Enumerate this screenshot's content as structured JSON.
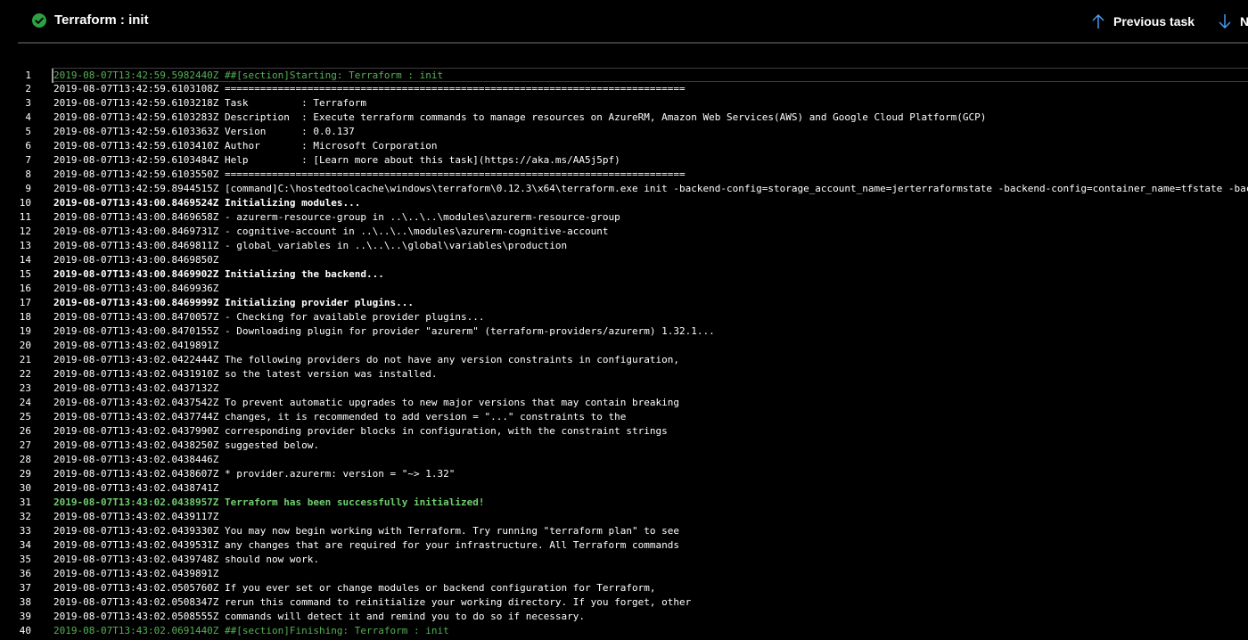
{
  "header": {
    "task_title": "Terraform : init",
    "status": "succeeded",
    "status_color": "#2ea043",
    "prev_label": "Previous task",
    "next_label": "N"
  },
  "log": {
    "lines": [
      {
        "num": "1",
        "text": "2019-08-07T13:42:59.5982440Z ##[section]Starting: Terraform : init",
        "style": "section first"
      },
      {
        "num": "2",
        "text": "2019-08-07T13:42:59.6103108Z ==============================================================================",
        "style": ""
      },
      {
        "num": "3",
        "text": "2019-08-07T13:42:59.6103218Z Task         : Terraform",
        "style": ""
      },
      {
        "num": "4",
        "text": "2019-08-07T13:42:59.6103283Z Description  : Execute terraform commands to manage resources on AzureRM, Amazon Web Services(AWS) and Google Cloud Platform(GCP)",
        "style": ""
      },
      {
        "num": "5",
        "text": "2019-08-07T13:42:59.6103363Z Version      : 0.0.137",
        "style": ""
      },
      {
        "num": "6",
        "text": "2019-08-07T13:42:59.6103410Z Author       : Microsoft Corporation",
        "style": ""
      },
      {
        "num": "7",
        "text": "2019-08-07T13:42:59.6103484Z Help         : [Learn more about this task](https://aka.ms/AA5j5pf)",
        "style": ""
      },
      {
        "num": "8",
        "text": "2019-08-07T13:42:59.6103550Z ==============================================================================",
        "style": ""
      },
      {
        "num": "9",
        "text": "2019-08-07T13:42:59.8944515Z [command]C:\\hostedtoolcache\\windows\\terraform\\0.12.3\\x64\\terraform.exe init -backend-config=storage_account_name=jerterraformstate -backend-config=container_name=tfstate -backend-config=key=production.terraform.tfstate",
        "style": ""
      },
      {
        "num": "10",
        "text": "2019-08-07T13:43:00.8469524Z Initializing modules...",
        "style": "bold"
      },
      {
        "num": "11",
        "text": "2019-08-07T13:43:00.8469658Z - azurerm-resource-group in ..\\..\\..\\modules\\azurerm-resource-group",
        "style": ""
      },
      {
        "num": "12",
        "text": "2019-08-07T13:43:00.8469731Z - cognitive-account in ..\\..\\..\\modules\\azurerm-cognitive-account",
        "style": ""
      },
      {
        "num": "13",
        "text": "2019-08-07T13:43:00.8469811Z - global_variables in ..\\..\\..\\global\\variables\\production",
        "style": ""
      },
      {
        "num": "14",
        "text": "2019-08-07T13:43:00.8469850Z",
        "style": ""
      },
      {
        "num": "15",
        "text": "2019-08-07T13:43:00.8469902Z Initializing the backend...",
        "style": "bold"
      },
      {
        "num": "16",
        "text": "2019-08-07T13:43:00.8469936Z",
        "style": ""
      },
      {
        "num": "17",
        "text": "2019-08-07T13:43:00.8469999Z Initializing provider plugins...",
        "style": "bold"
      },
      {
        "num": "18",
        "text": "2019-08-07T13:43:00.8470057Z - Checking for available provider plugins...",
        "style": ""
      },
      {
        "num": "19",
        "text": "2019-08-07T13:43:00.8470155Z - Downloading plugin for provider \"azurerm\" (terraform-providers/azurerm) 1.32.1...",
        "style": ""
      },
      {
        "num": "20",
        "text": "2019-08-07T13:43:02.0419891Z",
        "style": ""
      },
      {
        "num": "21",
        "text": "2019-08-07T13:43:02.0422444Z The following providers do not have any version constraints in configuration,",
        "style": ""
      },
      {
        "num": "22",
        "text": "2019-08-07T13:43:02.0431910Z so the latest version was installed.",
        "style": ""
      },
      {
        "num": "23",
        "text": "2019-08-07T13:43:02.0437132Z",
        "style": ""
      },
      {
        "num": "24",
        "text": "2019-08-07T13:43:02.0437542Z To prevent automatic upgrades to new major versions that may contain breaking",
        "style": ""
      },
      {
        "num": "25",
        "text": "2019-08-07T13:43:02.0437744Z changes, it is recommended to add version = \"...\" constraints to the",
        "style": ""
      },
      {
        "num": "26",
        "text": "2019-08-07T13:43:02.0437990Z corresponding provider blocks in configuration, with the constraint strings",
        "style": ""
      },
      {
        "num": "27",
        "text": "2019-08-07T13:43:02.0438250Z suggested below.",
        "style": ""
      },
      {
        "num": "28",
        "text": "2019-08-07T13:43:02.0438446Z",
        "style": ""
      },
      {
        "num": "29",
        "text": "2019-08-07T13:43:02.0438607Z * provider.azurerm: version = \"~> 1.32\"",
        "style": ""
      },
      {
        "num": "30",
        "text": "2019-08-07T13:43:02.0438741Z",
        "style": ""
      },
      {
        "num": "31",
        "text": "2019-08-07T13:43:02.0438957Z Terraform has been successfully initialized!",
        "style": "success"
      },
      {
        "num": "32",
        "text": "2019-08-07T13:43:02.0439117Z",
        "style": ""
      },
      {
        "num": "33",
        "text": "2019-08-07T13:43:02.0439330Z You may now begin working with Terraform. Try running \"terraform plan\" to see",
        "style": ""
      },
      {
        "num": "34",
        "text": "2019-08-07T13:43:02.0439531Z any changes that are required for your infrastructure. All Terraform commands",
        "style": ""
      },
      {
        "num": "35",
        "text": "2019-08-07T13:43:02.0439748Z should now work.",
        "style": ""
      },
      {
        "num": "36",
        "text": "2019-08-07T13:43:02.0439891Z",
        "style": ""
      },
      {
        "num": "37",
        "text": "2019-08-07T13:43:02.0505760Z If you ever set or change modules or backend configuration for Terraform,",
        "style": ""
      },
      {
        "num": "38",
        "text": "2019-08-07T13:43:02.0508347Z rerun this command to reinitialize your working directory. If you forget, other",
        "style": ""
      },
      {
        "num": "39",
        "text": "2019-08-07T13:43:02.0508555Z commands will detect it and remind you to do so if necessary.",
        "style": ""
      },
      {
        "num": "40",
        "text": "2019-08-07T13:43:02.0691440Z ##[section]Finishing: Terraform : init",
        "style": "section"
      }
    ]
  }
}
